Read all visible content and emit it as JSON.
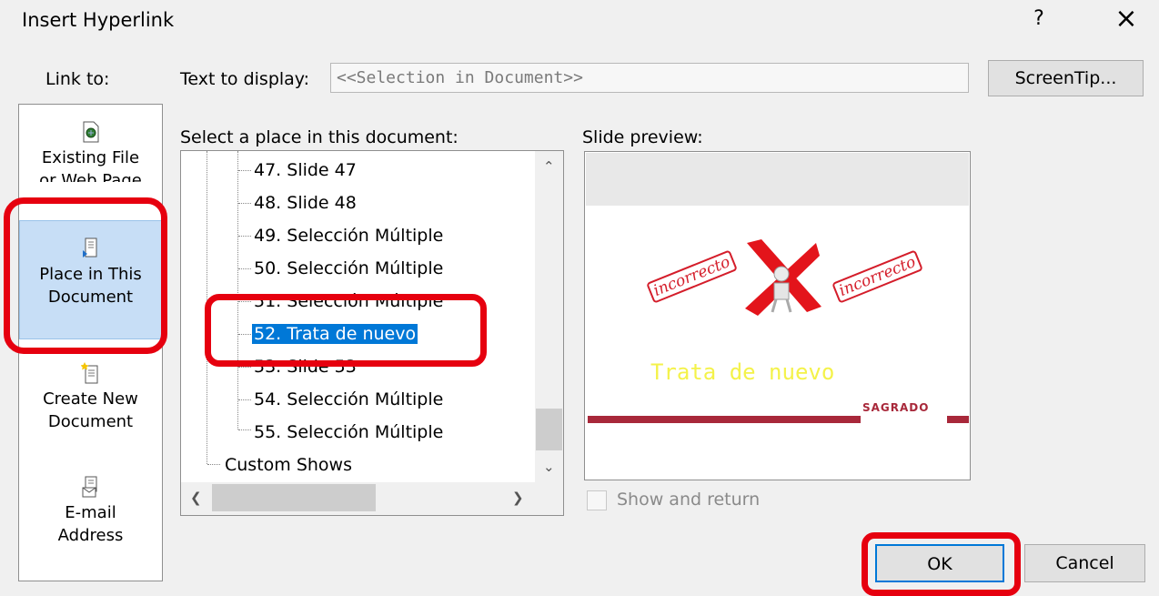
{
  "window": {
    "title": "Insert Hyperlink",
    "help": "?",
    "close": "×"
  },
  "link_to": {
    "label": "Link to:",
    "items": [
      {
        "line1": "Existing File",
        "line2": "or Web Page",
        "icon": "existing-file-icon"
      },
      {
        "line1": "Place in This",
        "line2": "Document",
        "icon": "place-in-document-icon",
        "selected": true
      },
      {
        "line1": "Create New",
        "line2": "Document",
        "icon": "create-new-document-icon"
      },
      {
        "line1": "E-mail",
        "line2": "Address",
        "icon": "email-address-icon"
      }
    ]
  },
  "text_to_display": {
    "label": "Text to display:",
    "value": "<<Selection in Document>>"
  },
  "screentip_label": "ScreenTip...",
  "place": {
    "label": "Select a place in this document:",
    "items": [
      "47. Slide 47",
      "48. Slide 48",
      "49. Selección Múltiple",
      "50. Selección Múltiple",
      "51. Selección Múltiple",
      "52. Trata de nuevo",
      "53. Slide 53",
      "54. Selección Múltiple",
      "55. Selección Múltiple"
    ],
    "selected_index": 5,
    "custom_shows": "Custom Shows"
  },
  "preview": {
    "label": "Slide preview:",
    "stamp_left": "incorrecto",
    "stamp_right": "incorrecto",
    "slide_text": "Trata de nuevo",
    "logo": "SAGRADO",
    "accent_color": "#a8283a"
  },
  "show_and_return": {
    "label": "Show and return",
    "checked": false
  },
  "buttons": {
    "ok": "OK",
    "cancel": "Cancel"
  },
  "colors": {
    "highlight": "#e6000f",
    "selection": "#0078d7"
  }
}
